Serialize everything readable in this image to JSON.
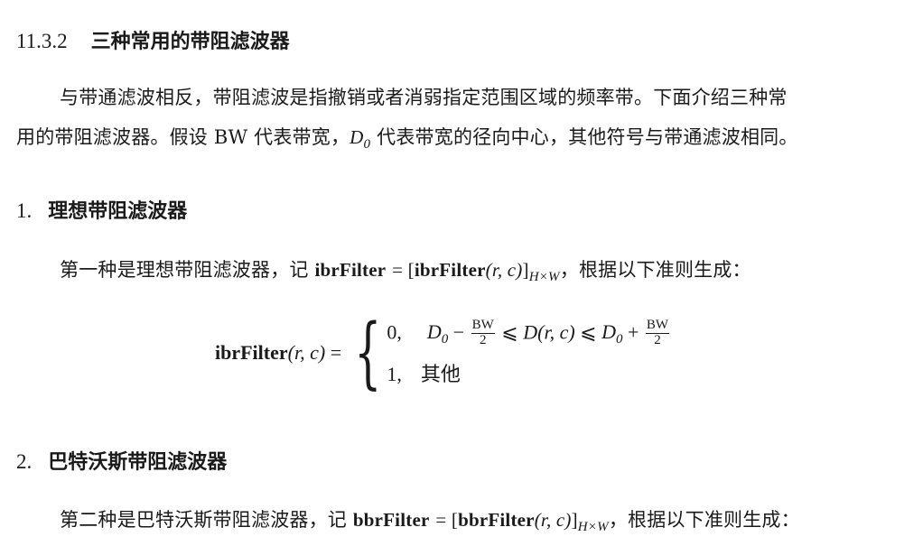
{
  "section": {
    "number": "11.3.2",
    "title": "三种常用的带阻滤波器"
  },
  "intro": {
    "line1": "与带通滤波相反，带阻滤波是指撤销或者消弱指定范围区域的频率带。下面介绍三种常",
    "line2_a": "用的带阻滤波器。假设 BW 代表带宽，",
    "line2_b": "代表带宽的径向中心，其他符号与带通滤波相同。"
  },
  "symbols": {
    "D": "D",
    "zero": "0",
    "rc": "(r, c)",
    "HxW": "H×W",
    "BW": "BW",
    "two": "2"
  },
  "sub1": {
    "number": "1.",
    "title": "理想带阻滤波器",
    "text_a": "第一种是理想带阻滤波器，记 ",
    "name": "ibrFilter",
    "text_b": "，根据以下准则生成："
  },
  "formula": {
    "lhs": "ibrFilter",
    "case1_value": "0,",
    "case2_value": "1,",
    "case2_cond": "其他"
  },
  "sub2": {
    "number": "2.",
    "title": "巴特沃斯带阻滤波器",
    "text_a": "第二种是巴特沃斯带阻滤波器，记 ",
    "name": "bbrFilter",
    "text_b": "，根据以下准则生成："
  }
}
